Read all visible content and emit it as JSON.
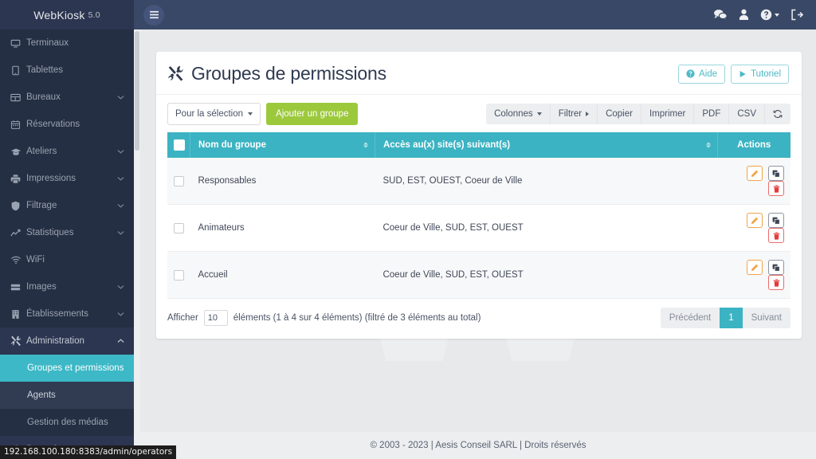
{
  "brand": {
    "name": "WebKiosk",
    "version": "5.0"
  },
  "sidebar": {
    "items": [
      {
        "label": "Terminaux",
        "icon": "monitor-icon",
        "caret": ""
      },
      {
        "label": "Tablettes",
        "icon": "tablet-icon",
        "caret": ""
      },
      {
        "label": "Bureaux",
        "icon": "grid-icon",
        "caret": "chevron-down"
      },
      {
        "label": "Réservations",
        "icon": "calendar-icon",
        "caret": ""
      },
      {
        "label": "Ateliers",
        "icon": "graduation-cap-icon",
        "caret": "chevron-down"
      },
      {
        "label": "Impressions",
        "icon": "printer-icon",
        "caret": "chevron-down"
      },
      {
        "label": "Filtrage",
        "icon": "shield-icon",
        "caret": "chevron-down"
      },
      {
        "label": "Statistiques",
        "icon": "chart-line-icon",
        "caret": "chevron-down"
      },
      {
        "label": "WiFi",
        "icon": "wifi-icon",
        "caret": ""
      },
      {
        "label": "Images",
        "icon": "server-icon",
        "caret": "chevron-down"
      },
      {
        "label": "Établissements",
        "icon": "building-icon",
        "caret": "chevron-down"
      },
      {
        "label": "Administration",
        "icon": "tools-icon",
        "caret": "chevron-up"
      }
    ],
    "submenu": [
      {
        "label": "Groupes et permissions",
        "state": "active"
      },
      {
        "label": "Agents",
        "state": "hover"
      },
      {
        "label": "Gestion des médias",
        "state": "normal"
      }
    ],
    "bottom": {
      "label": "Paramètres",
      "icon": "gear-icon"
    }
  },
  "topbar": {
    "menu_toggle": "hamburger-icon",
    "icons": [
      {
        "name": "comments-icon"
      },
      {
        "name": "user-icon"
      },
      {
        "name": "help-circle-icon",
        "caret": true
      },
      {
        "name": "logout-icon"
      }
    ]
  },
  "card": {
    "title": "Groupes de permissions",
    "title_icon": "tools-icon",
    "help_button": "Aide",
    "tutorial_button": "Tutoriel"
  },
  "toolbar": {
    "selection_dropdown": "Pour la sélection",
    "add_group": "Ajouter un groupe",
    "dt_buttons": [
      {
        "label": "Colonnes",
        "caret": "down"
      },
      {
        "label": "Filtrer",
        "caret": "right"
      },
      {
        "label": "Copier",
        "caret": ""
      },
      {
        "label": "Imprimer",
        "caret": ""
      },
      {
        "label": "PDF",
        "caret": ""
      },
      {
        "label": "CSV",
        "caret": ""
      },
      {
        "label": "",
        "caret": "",
        "icon": "refresh-icon"
      }
    ]
  },
  "table": {
    "columns": [
      "Nom du groupe",
      "Accès au(x) site(s) suivant(s)",
      "Actions"
    ],
    "rows": [
      {
        "name": "Responsables",
        "sites": "SUD, EST, OUEST, Coeur de Ville"
      },
      {
        "name": "Animateurs",
        "sites": "Coeur de Ville, SUD, EST, OUEST"
      },
      {
        "name": "Accueil",
        "sites": "Coeur de Ville, SUD, EST, OUEST"
      }
    ],
    "row_actions": [
      {
        "name": "edit-button",
        "icon": "pencil-icon"
      },
      {
        "name": "duplicate-button",
        "icon": "copy-icon"
      },
      {
        "name": "delete-button",
        "icon": "trash-icon"
      }
    ]
  },
  "table_footer": {
    "show_label": "Afficher",
    "page_length": "10",
    "info": "éléments (1 à 4 sur 4 éléments) (filtré de 3 éléments au total)",
    "pagination": {
      "previous": "Précédent",
      "current": "1",
      "next": "Suivant"
    }
  },
  "footer": {
    "copyright": "© 2003 - 2023 | Aesis Conseil SARL | Droits réservés"
  },
  "status_bar": {
    "url": "192.168.100.180:8383/admin/operators"
  },
  "watermark": {
    "text": "W"
  },
  "colors": {
    "sidebar_bg": "#252f43",
    "topbar_bg": "#394866",
    "accent_teal": "#3cb3c2",
    "accent_green": "#9cc93c",
    "edit_orange": "#f0a44a",
    "delete_red": "#ef6b6b",
    "content_bg": "#e8e9eb"
  }
}
